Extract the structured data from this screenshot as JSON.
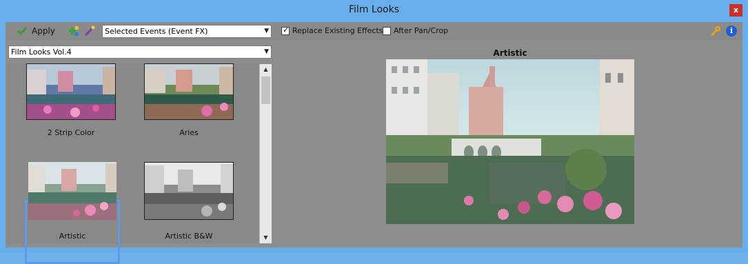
{
  "window": {
    "title": "Film Looks",
    "close_label": "x"
  },
  "toolbar": {
    "apply_label": "Apply",
    "target_select": "Selected Events (Event FX)",
    "replace_label": "Replace Existing Effects",
    "replace_checked": true,
    "after_pan_label": "After Pan/Crop",
    "after_pan_checked": false,
    "info_icon": "i"
  },
  "presets": {
    "bank_select": "Film Looks Vol.4",
    "items": [
      {
        "label": "2 Strip Color"
      },
      {
        "label": "Aries"
      },
      {
        "label": "Artistic"
      },
      {
        "label": "Artistic B&W"
      }
    ],
    "selected": "Artistic"
  },
  "preview": {
    "title": "Artistic"
  },
  "colors": {
    "accent": "#5b9bef",
    "titlebar": "#67aeeb",
    "panel": "#8d8d8d"
  }
}
